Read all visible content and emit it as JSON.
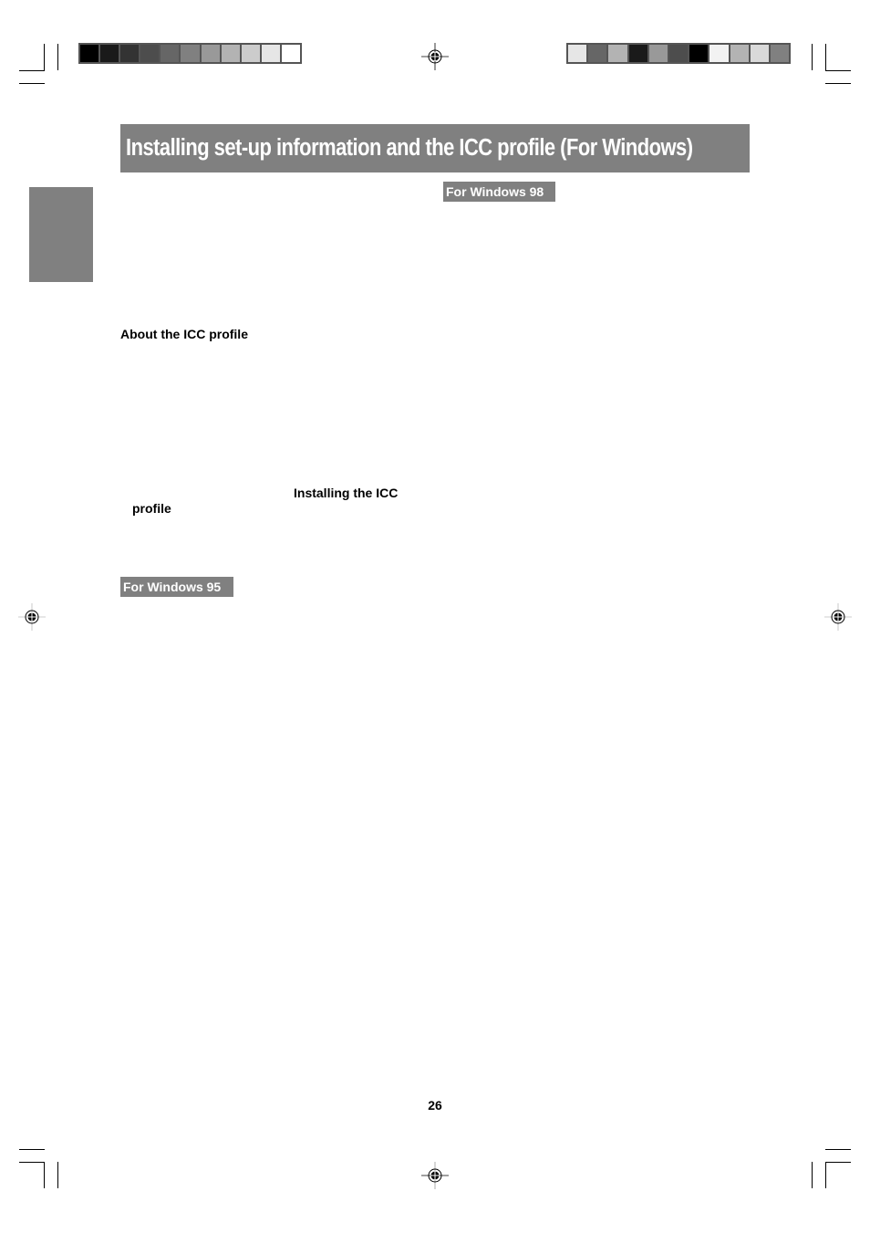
{
  "page": {
    "title": "Installing set-up information and the ICC profile (For Windows)",
    "section_tags": {
      "windows98": "For Windows 98",
      "windows95": "For Windows 95"
    },
    "headings": {
      "about_icc": "About the ICC profile",
      "installing_icc_part1": "Installing the ICC",
      "installing_icc_part2": "profile"
    },
    "page_number": "26"
  },
  "print_marks": {
    "left_gray_scale": [
      "#000000",
      "#1a1a1a",
      "#333333",
      "#4d4d4d",
      "#666666",
      "#808080",
      "#999999",
      "#b3b3b3",
      "#cccccc",
      "#e6e6e6",
      "#ffffff"
    ],
    "right_gray_scale": [
      "#e6e6e6",
      "#666666",
      "#b3b3b3",
      "#1a1a1a",
      "#999999",
      "#4d4d4d",
      "#000000",
      "#f2f2f2",
      "#b3b3b3",
      "#d9d9d9",
      "#808080"
    ]
  },
  "colors": {
    "accent_gray": "#808080"
  }
}
